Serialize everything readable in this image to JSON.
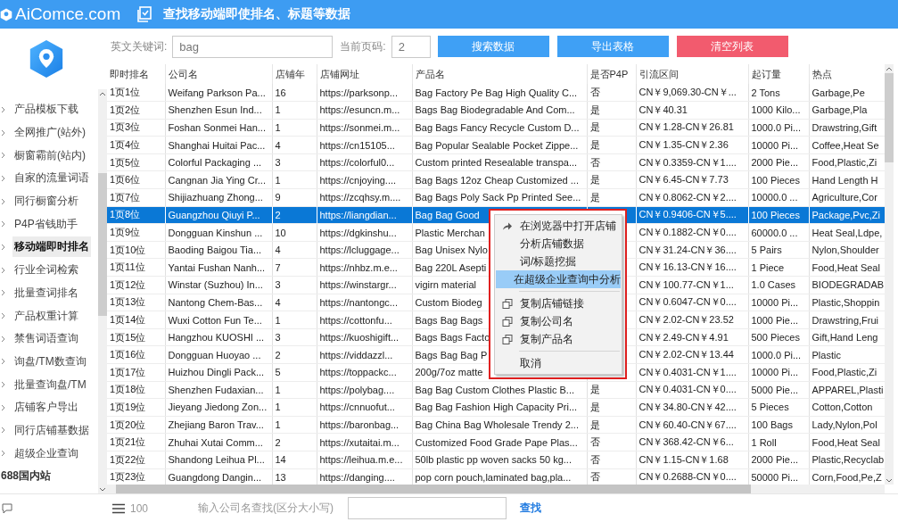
{
  "header": {
    "brand": "AiComce.com",
    "title": "查找移动端即使排名、标题等数据"
  },
  "sidebar": {
    "items": [
      {
        "label": "产品模板下载",
        "selected": false,
        "kind": "item"
      },
      {
        "label": "全网推广(站外)",
        "selected": false,
        "kind": "item"
      },
      {
        "label": "橱窗霸前(站内)",
        "selected": false,
        "kind": "item"
      },
      {
        "label": "自家的流量词语",
        "selected": false,
        "kind": "item"
      },
      {
        "label": "同行橱窗分析",
        "selected": false,
        "kind": "item"
      },
      {
        "label": "P4P省钱助手",
        "selected": false,
        "kind": "item"
      },
      {
        "label": "移动端即时排名",
        "selected": true,
        "kind": "item"
      },
      {
        "label": "行业全词检索",
        "selected": false,
        "kind": "item"
      },
      {
        "label": "批量查词排名",
        "selected": false,
        "kind": "item"
      },
      {
        "label": "产品权重计算",
        "selected": false,
        "kind": "item"
      },
      {
        "label": "禁售词语查询",
        "selected": false,
        "kind": "item"
      },
      {
        "label": "询盘/TM数查询",
        "selected": false,
        "kind": "item"
      },
      {
        "label": "批量查询盘/TM",
        "selected": false,
        "kind": "item"
      },
      {
        "label": "店铺客户导出",
        "selected": false,
        "kind": "item"
      },
      {
        "label": "同行店铺基数据",
        "selected": false,
        "kind": "item"
      },
      {
        "label": "超级企业查询",
        "selected": false,
        "kind": "item"
      },
      {
        "label": "688国内站",
        "kind": "section"
      }
    ]
  },
  "toolbar": {
    "keyword_label": "英文关键词:",
    "keyword": "bag",
    "page_label": "当前页码:",
    "page": "2",
    "buttons": [
      {
        "label": "搜索数据",
        "kind": "primary"
      },
      {
        "label": "导出表格",
        "kind": "primary"
      },
      {
        "label": "清空列表",
        "kind": "danger"
      }
    ]
  },
  "table": {
    "columns": [
      "即时排名",
      "公司名",
      "店铺年",
      "店铺网址",
      "产品名",
      "是否P4P",
      "引流区间",
      "起订量",
      "热点"
    ],
    "rows": [
      {
        "selected": false,
        "cells": [
          "1页1位",
          "Weifang Parkson Pa...",
          "16",
          "https://parksonp...",
          "Bag Factory Pe Bag High Quality C...",
          "否",
          "CN￥9,069.30-CN￥...",
          "2 Tons",
          "Garbage,Pe"
        ]
      },
      {
        "selected": false,
        "cells": [
          "1页2位",
          "Shenzhen Esun Ind...",
          "1",
          "https://esuncn.m...",
          "Bags Bag Biodegradable And Com...",
          "是",
          "CN￥40.31",
          "1000 Kilo...",
          "Garbage,Pla"
        ]
      },
      {
        "selected": false,
        "cells": [
          "1页3位",
          "Foshan Sonmei Han...",
          "1",
          "https://sonmei.m...",
          "Bag Bags Fancy Recycle Custom D...",
          "是",
          "CN￥1.28-CN￥26.81",
          "1000.0 Pi...",
          "Drawstring,Gift"
        ]
      },
      {
        "selected": false,
        "cells": [
          "1页4位",
          "Shanghai Huitai Pac...",
          "4",
          "https://cn15105...",
          "Bag Popular Sealable Pocket Zippe...",
          "是",
          "CN￥1.35-CN￥2.36",
          "10000 Pi...",
          "Coffee,Heat Se"
        ]
      },
      {
        "selected": false,
        "cells": [
          "1页5位",
          "Colorful Packaging ...",
          "3",
          "https://colorful0...",
          "Custom printed Resealable transpa...",
          "否",
          "CN￥0.3359-CN￥1....",
          "2000 Pie...",
          "Food,Plastic,Zi"
        ]
      },
      {
        "selected": false,
        "cells": [
          "1页6位",
          "Cangnan Jia Ying Cr...",
          "1",
          "https://cnjoying....",
          "Bag Bags 12oz Cheap Customized ...",
          "是",
          "CN￥6.45-CN￥7.73",
          "100 Pieces",
          "Hand Length H"
        ]
      },
      {
        "selected": false,
        "cells": [
          "1页7位",
          "Shijiazhuang Zhong...",
          "9",
          "https://zcqhsy.m....",
          "Bag Bags Poly Sack Pp Printed See...",
          "是",
          "CN￥0.8062-CN￥2....",
          "10000.0 ...",
          "Agriculture,Cor"
        ]
      },
      {
        "selected": true,
        "cells": [
          "1页8位",
          "Guangzhou Qiuyi P...",
          "2",
          "https://liangdian...",
          "Bag Bag Good",
          null,
          "CN￥0.9406-CN￥5....",
          "100 Pieces",
          "Package,Pvc,Zi"
        ]
      },
      {
        "selected": false,
        "cells": [
          "1页9位",
          "Dongguan Kinshun ...",
          "10",
          "https://dgkinshu...",
          "Plastic Merchan",
          null,
          "CN￥0.1882-CN￥0....",
          "60000.0 ...",
          "Heat Seal,Ldpe,"
        ]
      },
      {
        "selected": false,
        "cells": [
          "1页10位",
          "Baoding Baigou Tia...",
          "4",
          "https://lcluggage...",
          "Bag Unisex Nylo",
          null,
          "CN￥31.24-CN￥36....",
          "5 Pairs",
          "Nylon,Shoulder"
        ]
      },
      {
        "selected": false,
        "cells": [
          "1页11位",
          "Yantai Fushan Nanh...",
          "7",
          "https://nhbz.m.e...",
          "Bag 220L Asepti",
          null,
          "CN￥16.13-CN￥16....",
          "1 Piece",
          "Food,Heat Seal"
        ]
      },
      {
        "selected": false,
        "cells": [
          "1页12位",
          "Winstar (Suzhou) In...",
          "3",
          "https://winstargr...",
          "vigirn material",
          null,
          "CN￥100.77-CN￥1...",
          "1.0 Cases",
          "BIODEGRADAB"
        ]
      },
      {
        "selected": false,
        "cells": [
          "1页13位",
          "Nantong Chem-Bas...",
          "4",
          "https://nantongc...",
          "Custom Biodeg",
          null,
          "CN￥0.6047-CN￥0....",
          "10000 Pi...",
          "Plastic,Shoppin"
        ]
      },
      {
        "selected": false,
        "cells": [
          "1页14位",
          "Wuxi Cotton Fun Te...",
          "1",
          "https://cottonfu...",
          "Bags Bag Bags",
          null,
          "CN￥2.02-CN￥23.52",
          "1000 Pie...",
          "Drawstring,Frui"
        ]
      },
      {
        "selected": false,
        "cells": [
          "1页15位",
          "Hangzhou KUOSHI ...",
          "3",
          "https://kuoshigift...",
          "Bags Bags Facto",
          null,
          "CN￥2.49-CN￥4.91",
          "500 Pieces",
          "Gift,Hand Leng"
        ]
      },
      {
        "selected": false,
        "cells": [
          "1页16位",
          "Dongguan Huoyao ...",
          "2",
          "https://viddazzl...",
          "Bags Bag Bag P",
          null,
          "CN￥2.02-CN￥13.44",
          "1000.0 Pi...",
          "Plastic"
        ]
      },
      {
        "selected": false,
        "cells": [
          "1页17位",
          "Huizhou Dingli Pack...",
          "5",
          "https://toppackc...",
          "200g/7oz matte",
          null,
          "CN￥0.4031-CN￥1....",
          "10000 Pi...",
          "Food,Plastic,Zi"
        ]
      },
      {
        "selected": false,
        "cells": [
          "1页18位",
          "Shenzhen Fudaxian...",
          "1",
          "https://polybag....",
          "Bag Bag Custom Clothes Plastic B...",
          "是",
          "CN￥0.4031-CN￥0....",
          "5000 Pie...",
          "APPAREL,Plasti"
        ]
      },
      {
        "selected": false,
        "cells": [
          "1页19位",
          "Jieyang Jiedong Zon...",
          "1",
          "https://cnnuofut...",
          "Bag Bag Fashion High Capacity Pri...",
          "是",
          "CN￥34.80-CN￥42....",
          "5 Pieces",
          "Cotton,Cotton"
        ]
      },
      {
        "selected": false,
        "cells": [
          "1页20位",
          "Zhejiang Baron Trav...",
          "1",
          "https://baronbag...",
          "Bag China Bag Wholesale Trendy 2...",
          "是",
          "CN￥60.40-CN￥67....",
          "100 Bags",
          "Lady,Nylon,Pol"
        ]
      },
      {
        "selected": false,
        "cells": [
          "1页21位",
          "Zhuhai Xutai Comm...",
          "2",
          "https://xutaitai.m...",
          "Customized Food Grade Pape Plas...",
          "否",
          "CN￥368.42-CN￥6...",
          "1 Roll",
          "Food,Heat Seal"
        ]
      },
      {
        "selected": false,
        "cells": [
          "1页22位",
          "Shandong Leihua Pl...",
          "14",
          "https://leihua.m.e...",
          "50lb plastic pp woven sacks 50 kg...",
          "否",
          "CN￥1.15-CN￥1.68",
          "2000 Pie...",
          "Plastic,Recyclab"
        ]
      },
      {
        "selected": false,
        "cells": [
          "1页23位",
          "Guangdong Dangin...",
          "13",
          "https://danging....",
          "pop corn pouch,laminated bag,pla...",
          "否",
          "CN￥0.2688-CN￥0....",
          "50000 Pi...",
          "Corn,Food,Pe,Z"
        ]
      }
    ]
  },
  "context_menu": {
    "items": [
      {
        "label": "在浏览器中打开店铺",
        "kind": "open",
        "selected": false
      },
      {
        "label": "分析店铺数据",
        "kind": "plain",
        "selected": false
      },
      {
        "label": "词/标题挖掘",
        "kind": "plain",
        "selected": false
      },
      {
        "label": "在超级企业查询中分析",
        "kind": "plain",
        "selected": true
      },
      {
        "kind": "separator"
      },
      {
        "label": "复制店铺链接",
        "kind": "copy",
        "selected": false
      },
      {
        "label": "复制公司名",
        "kind": "copy",
        "selected": false
      },
      {
        "label": "复制产品名",
        "kind": "copy",
        "selected": false
      },
      {
        "kind": "separator"
      },
      {
        "label": "取消",
        "kind": "plain",
        "selected": false
      }
    ]
  },
  "footer": {
    "page_size": "100",
    "search_label": "输入公司名查找(区分大小写)",
    "search_button": "查找"
  }
}
